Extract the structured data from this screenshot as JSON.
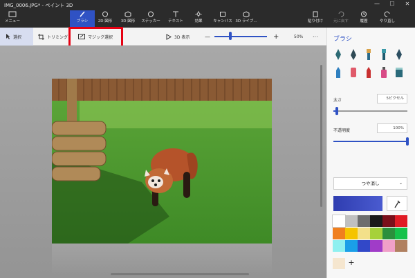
{
  "title": "IMG_0006.JPG* - ペイント 3D",
  "window_controls": [
    "—",
    "☐",
    "✕"
  ],
  "ribbon": {
    "menu": "メニュー",
    "brushes": "ブラシ",
    "shapes2d": "2D 図形",
    "shapes3d": "3D 図形",
    "stickers": "ステッカー",
    "text": "テキスト",
    "effects": "効果",
    "canvas": "キャンバス",
    "library3d": "3D ライブ...",
    "paste": "貼り付け",
    "undo": "元に戻す",
    "history": "履歴",
    "redo": "やり直し"
  },
  "toolbar": {
    "select": "選択",
    "crop": "トリミング",
    "magic_select": "マジック選択",
    "view3d": "3D 表示",
    "zoom_minus": "—",
    "zoom_plus": "+",
    "zoom_value": "50%",
    "more": "···",
    "zoom_level": 0.3
  },
  "panel": {
    "title": "ブラシ",
    "thickness_label": "太さ",
    "thickness_value": "5ピクセル",
    "thickness_level": 0.05,
    "opacity_label": "不透明度",
    "opacity_value": "100%",
    "opacity_level": 1.0,
    "finish": "つや消し",
    "current_color": "#2f3db0",
    "plus": "+"
  },
  "palette": [
    "#ffffff",
    "#c0c0c0",
    "#6e6e6e",
    "#1a1a1a",
    "#7a0f1a",
    "#e01b24",
    "#f07f1e",
    "#f5c400",
    "#f3e08a",
    "#a6d13a",
    "#2c8f3c",
    "#16c24a",
    "#8ff0f0",
    "#1a9fe8",
    "#3248c8",
    "#a03cc8",
    "#f0a0c8",
    "#b08060"
  ],
  "custom_color": "#f5e6cf",
  "photo_alt": "レッサーパンダ"
}
